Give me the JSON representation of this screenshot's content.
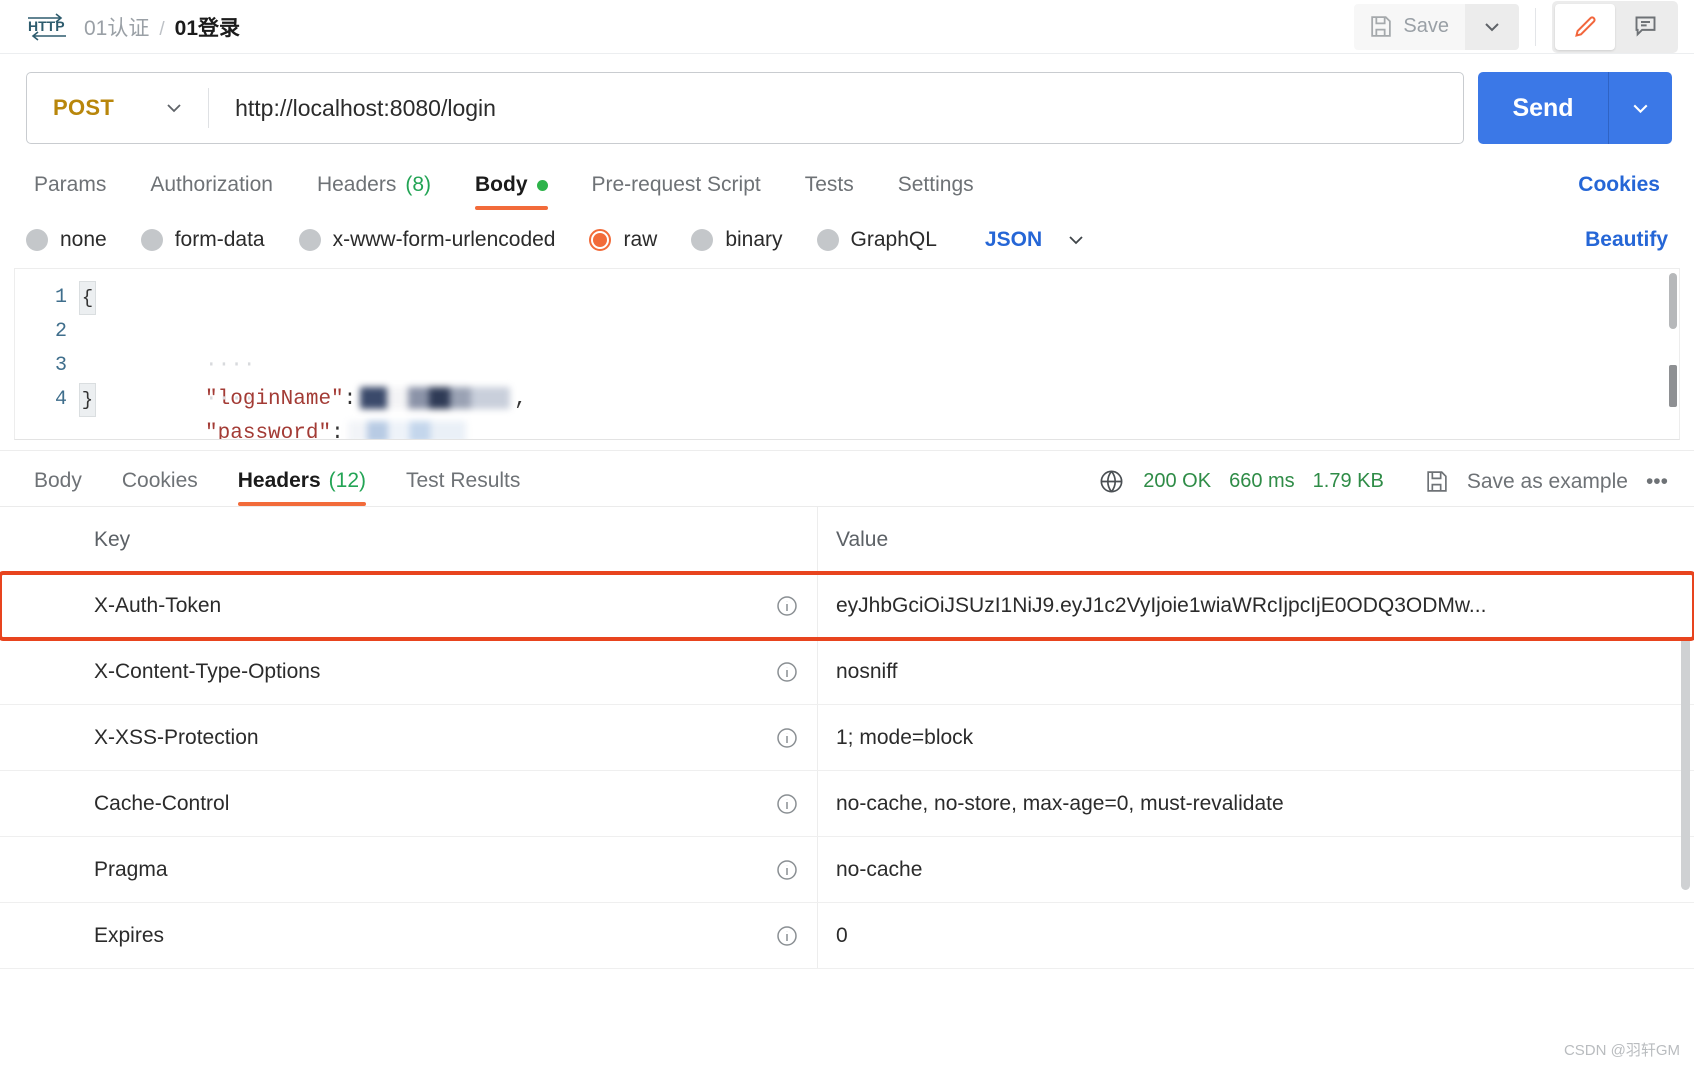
{
  "topbar": {
    "protocol_icon": "http-icon",
    "breadcrumb_parent": "01认证",
    "breadcrumb_sep": "/",
    "breadcrumb_current": "01登录",
    "save_label": "Save",
    "save_icon": "floppy-disk-icon",
    "save_caret_icon": "chevron-down-icon",
    "edit_icon": "pencil-icon",
    "comment_icon": "comment-icon"
  },
  "request": {
    "method": "POST",
    "method_caret_icon": "chevron-down-icon",
    "url": "http://localhost:8080/login",
    "send_label": "Send",
    "send_caret_icon": "chevron-down-icon",
    "tabs": [
      {
        "label": "Params",
        "active": false
      },
      {
        "label": "Authorization",
        "active": false
      },
      {
        "label": "Headers",
        "count": "(8)",
        "active": false
      },
      {
        "label": "Body",
        "active": true,
        "dot": true
      },
      {
        "label": "Pre-request Script",
        "active": false
      },
      {
        "label": "Tests",
        "active": false
      },
      {
        "label": "Settings",
        "active": false
      }
    ],
    "cookies_link": "Cookies",
    "body_types": [
      {
        "label": "none",
        "selected": false
      },
      {
        "label": "form-data",
        "selected": false
      },
      {
        "label": "x-www-form-urlencoded",
        "selected": false
      },
      {
        "label": "raw",
        "selected": true
      },
      {
        "label": "binary",
        "selected": false
      },
      {
        "label": "GraphQL",
        "selected": false
      }
    ],
    "raw_format": "JSON",
    "raw_format_caret_icon": "chevron-down-icon",
    "beautify_label": "Beautify"
  },
  "editor": {
    "line_numbers": [
      "1",
      "2",
      "3",
      "4"
    ],
    "lines": [
      {
        "no": "1",
        "brace": "{",
        "fold": true
      },
      {
        "no": "2",
        "indent": "····",
        "key": "\"loginName\"",
        "colon": ":",
        "value_redacted": true,
        "trailing": ","
      },
      {
        "no": "3",
        "indent": "····",
        "key": "\"password\"",
        "colon": ":",
        "value_redacted": true,
        "trailing": ""
      },
      {
        "no": "4",
        "brace": "}",
        "fold": true
      }
    ]
  },
  "response": {
    "tabs": [
      {
        "label": "Body",
        "active": false
      },
      {
        "label": "Cookies",
        "active": false
      },
      {
        "label": "Headers",
        "count": "(12)",
        "active": true
      },
      {
        "label": "Test Results",
        "active": false
      }
    ],
    "globe_icon": "globe-icon",
    "status": "200 OK",
    "time": "660 ms",
    "size": "1.79 KB",
    "save_example_icon": "floppy-disk-icon",
    "save_example_label": "Save as example",
    "more_label": "•••",
    "table": {
      "columns": [
        "Key",
        "Value"
      ],
      "info_icon": "info-icon",
      "rows": [
        {
          "key": "X-Auth-Token",
          "value": "eyJhbGciOiJSUzI1NiJ9.eyJ1c2VyIjoie1wiaWRcIjpcIjE0ODQ3ODMw...",
          "highlighted": true
        },
        {
          "key": "X-Content-Type-Options",
          "value": "nosniff",
          "highlighted": false
        },
        {
          "key": "X-XSS-Protection",
          "value": "1; mode=block",
          "highlighted": false
        },
        {
          "key": "Cache-Control",
          "value": "no-cache, no-store, max-age=0, must-revalidate",
          "highlighted": false
        },
        {
          "key": "Pragma",
          "value": "no-cache",
          "highlighted": false
        },
        {
          "key": "Expires",
          "value": "0",
          "highlighted": false
        }
      ]
    }
  },
  "watermark": "CSDN @羽轩GM",
  "colors": {
    "accent_orange": "#f26b3a",
    "highlight_red": "#e8441e",
    "send_blue": "#3b78e7",
    "link_blue": "#2566d6",
    "method_amber": "#b8860b",
    "status_green": "#2f8c47"
  }
}
